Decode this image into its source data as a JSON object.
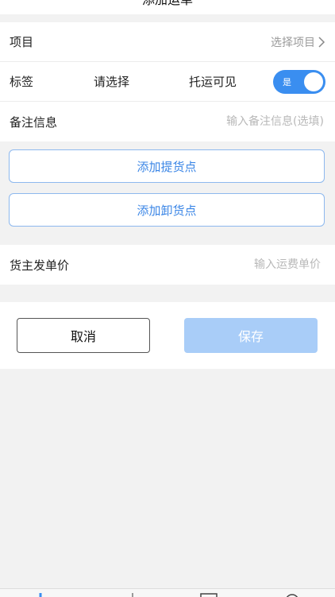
{
  "navbar": {
    "title": "添加运单"
  },
  "form": {
    "project": {
      "label": "项目",
      "value": "选择项目"
    },
    "tag": {
      "label": "标签",
      "value": "请选择"
    },
    "carrier_visible": {
      "label": "托运可见",
      "toggle_text": "是",
      "on": true
    },
    "remark": {
      "label": "备注信息",
      "placeholder": "输入备注信息(选填)"
    },
    "pickup_button": "添加提货点",
    "unload_button": "添加卸货点",
    "shipper_price": {
      "label": "货主发单价",
      "placeholder": "输入运费单价"
    }
  },
  "actions": {
    "cancel": "取消",
    "save": "保存"
  },
  "colors": {
    "accent": "#3a8ef0",
    "disabled_save": "#a9cdf8",
    "outline": "#8db8ee"
  },
  "tabbar": {
    "icons": [
      "home-icon",
      "waybill-icon",
      "message-icon",
      "user-icon"
    ]
  }
}
